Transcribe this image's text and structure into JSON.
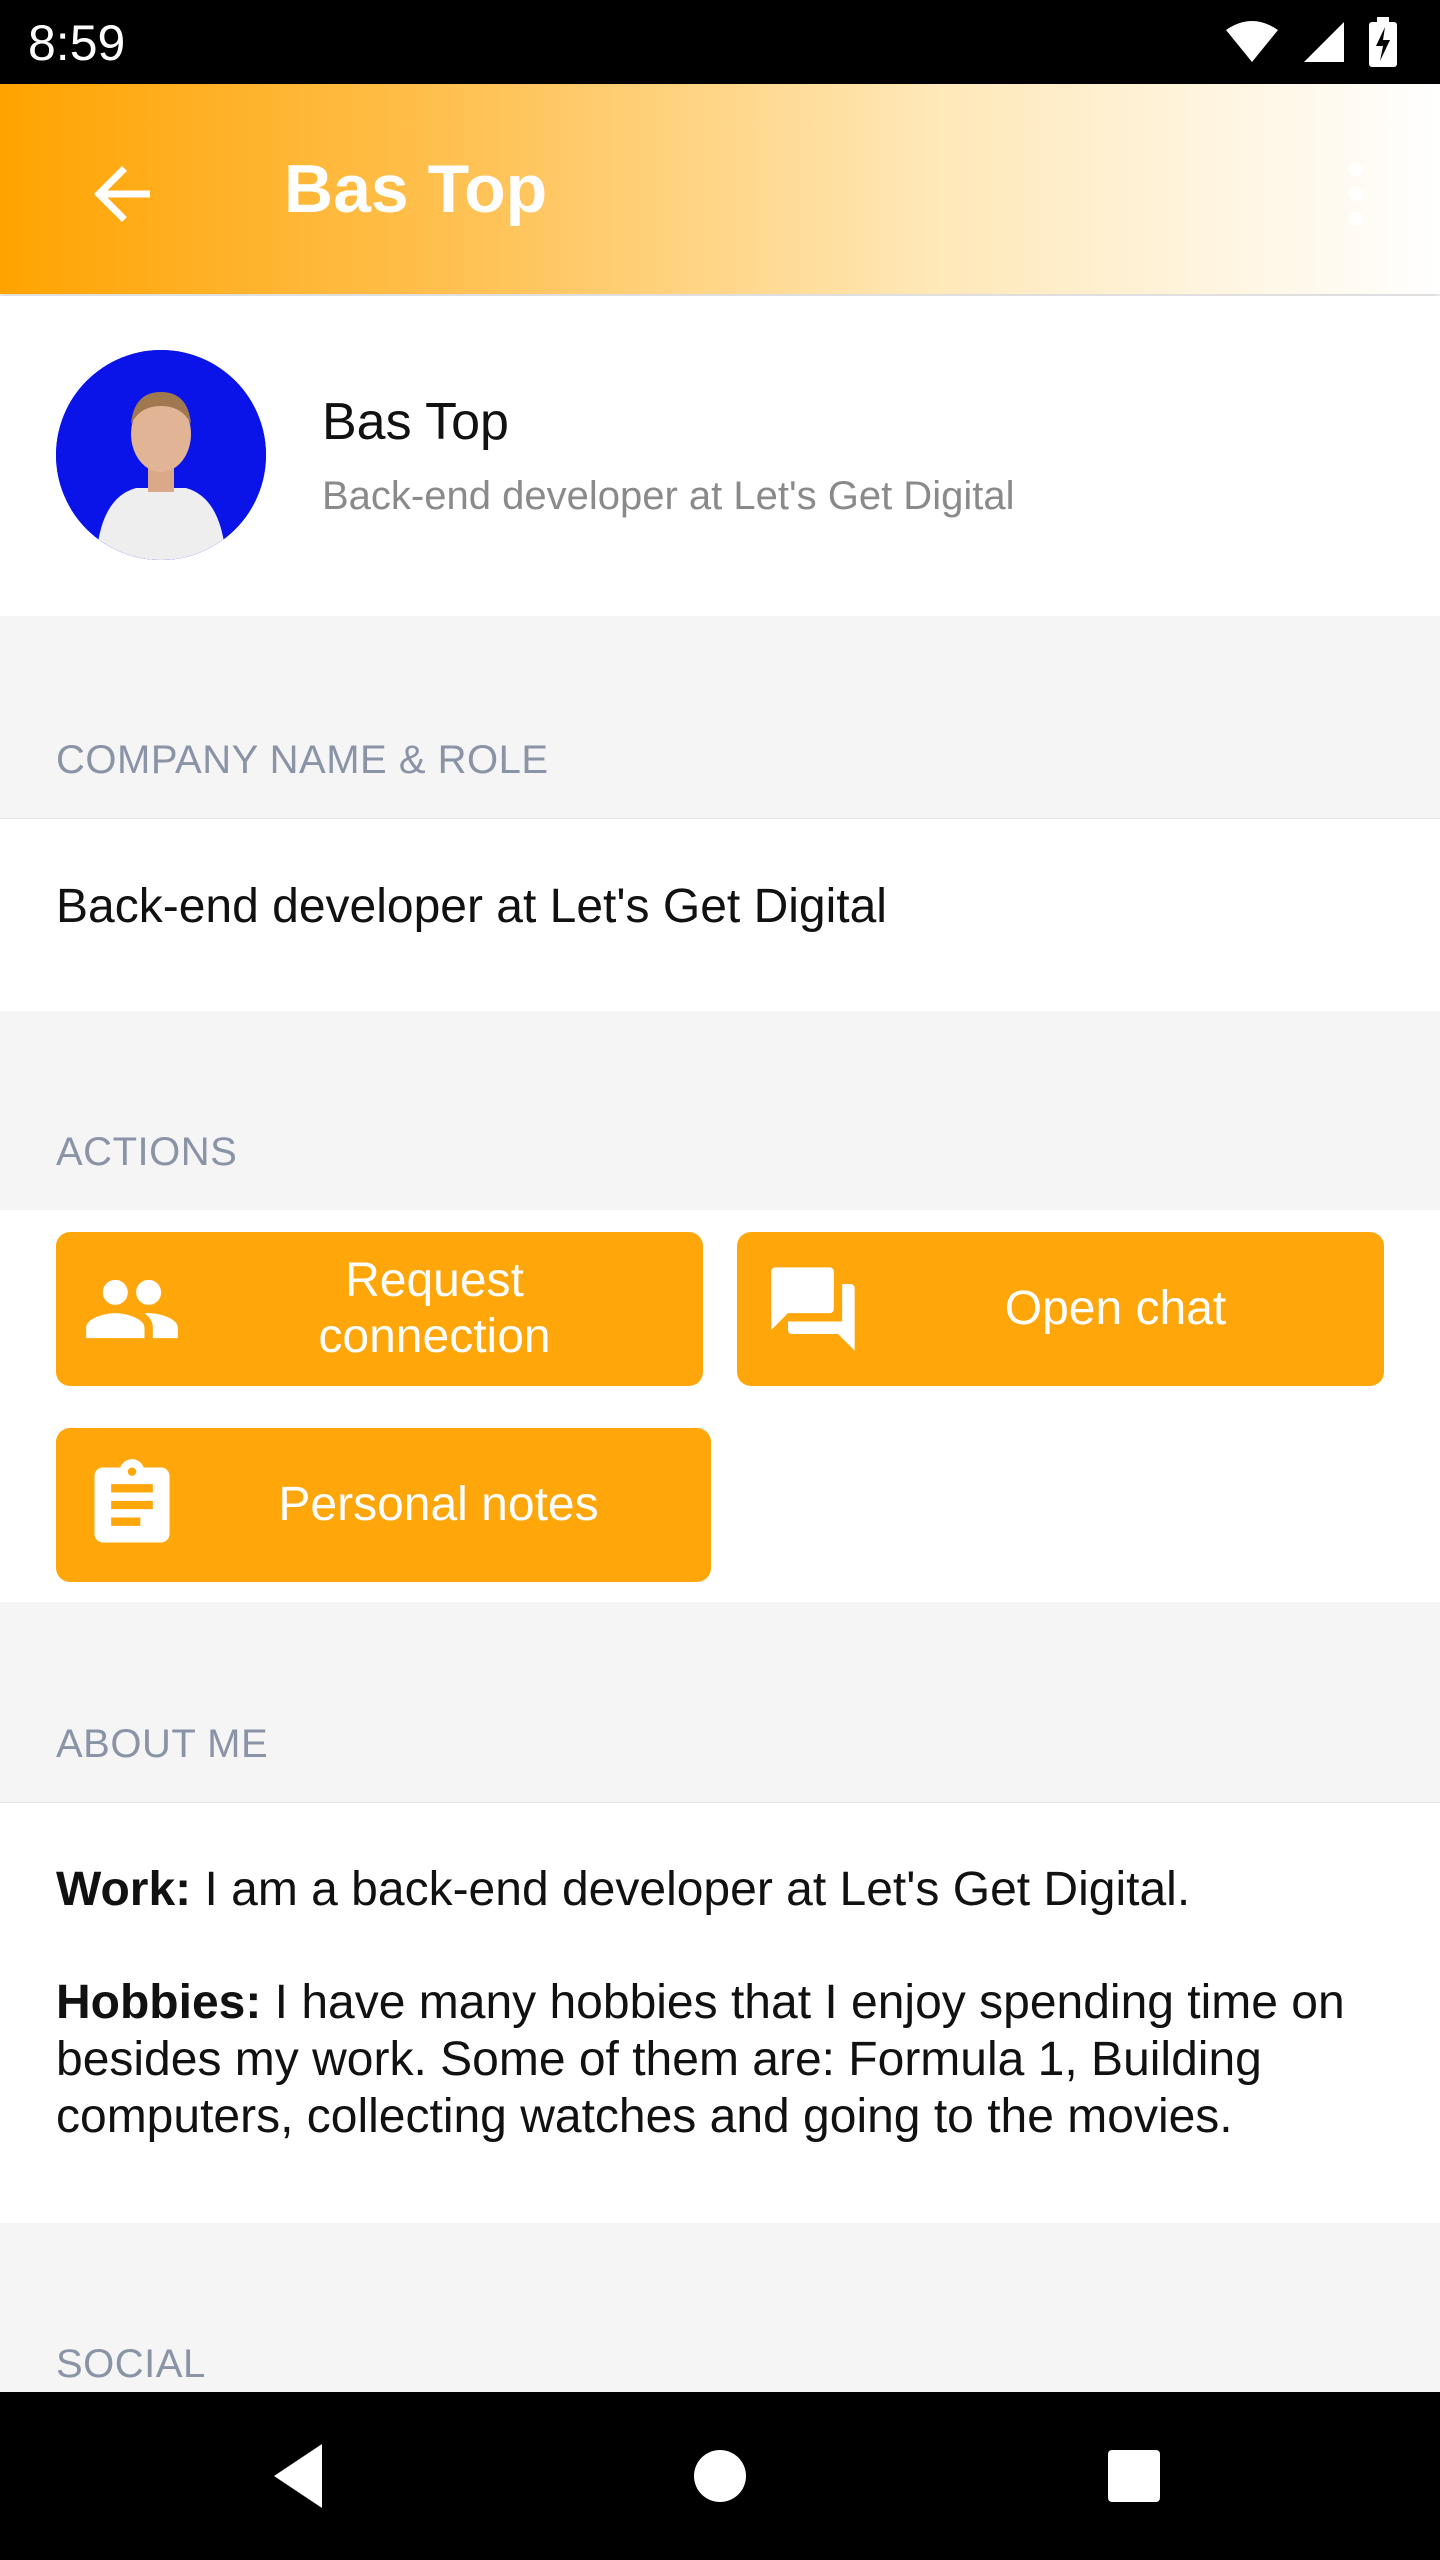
{
  "status_bar": {
    "time": "8:59",
    "icons": [
      "wifi-icon",
      "cell-signal-icon",
      "battery-charging-icon"
    ]
  },
  "app_bar": {
    "title": "Bas Top",
    "back_icon": "arrow-back-icon",
    "menu_icon": "more-vert-icon"
  },
  "profile": {
    "name": "Bas Top",
    "role": "Back-end developer at Let's Get Digital"
  },
  "company_section": {
    "label": "COMPANY NAME & ROLE",
    "value": "Back-end developer at Let's Get Digital"
  },
  "actions_section": {
    "label": "ACTIONS",
    "buttons": [
      {
        "label": "Request connection",
        "icon": "people-icon"
      },
      {
        "label": "Open chat",
        "icon": "chat-icon"
      },
      {
        "label": "Personal notes",
        "icon": "clipboard-icon"
      }
    ]
  },
  "about_section": {
    "label": "ABOUT ME",
    "work_label": "Work:",
    "work_text": " I am a back-end developer at Let's Get Digital.",
    "hobbies_label": "Hobbies:",
    "hobbies_text": " I have many hobbies that I enjoy spending time on besides my work. Some of them are: Formula 1, Building computers, collecting watches and going to the movies."
  },
  "social_section": {
    "label": "SOCIAL"
  },
  "nav_bar": {
    "buttons": [
      "nav-back-icon",
      "nav-home-icon",
      "nav-recents-icon"
    ]
  },
  "colors": {
    "accent": "#ffa70a",
    "section_label": "#8a94a6",
    "background": "#f5f5f5"
  }
}
